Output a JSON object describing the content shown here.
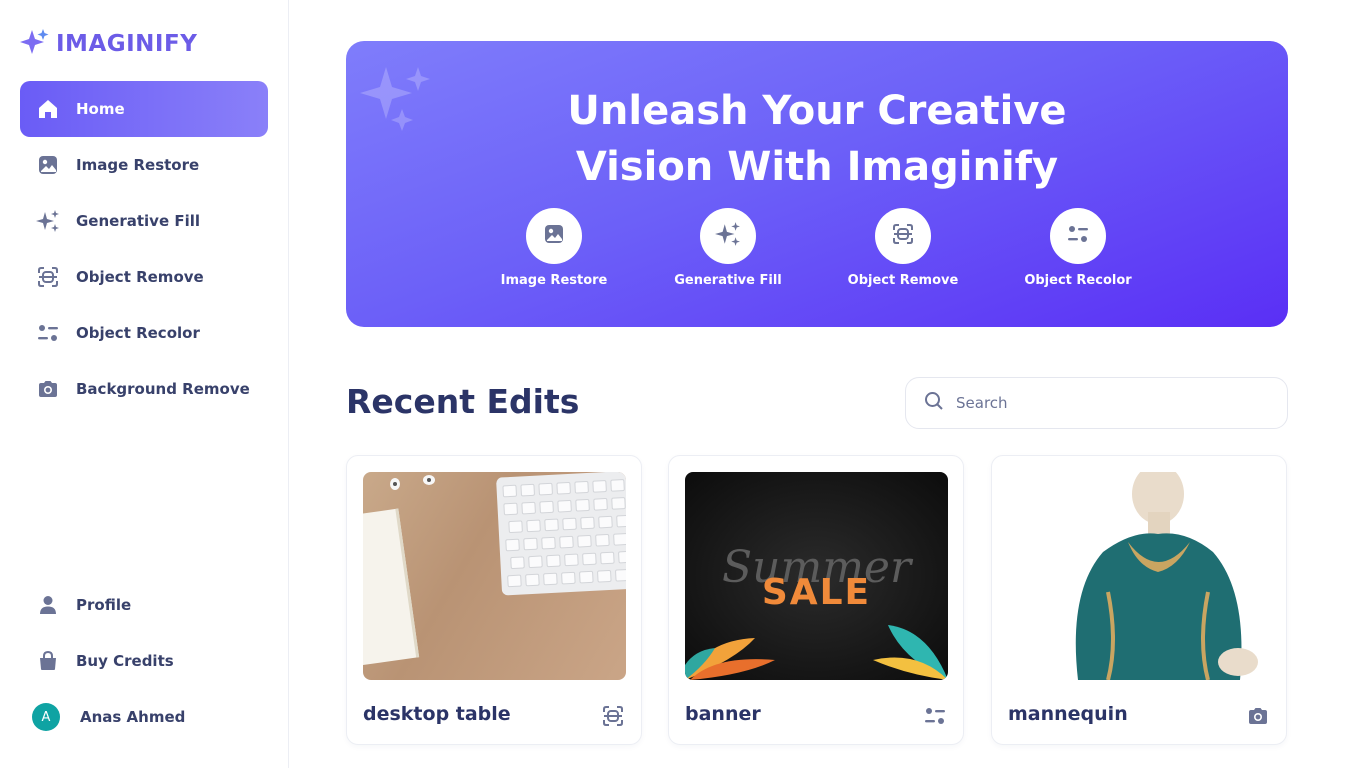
{
  "app": {
    "logo_text": "IMAGINIFY"
  },
  "sidebar": {
    "items": [
      {
        "label": "Home",
        "icon": "home-icon",
        "active": true
      },
      {
        "label": "Image Restore",
        "icon": "image-icon"
      },
      {
        "label": "Generative Fill",
        "icon": "sparkles-icon"
      },
      {
        "label": "Object Remove",
        "icon": "scan-icon"
      },
      {
        "label": "Object Recolor",
        "icon": "filter-icon"
      },
      {
        "label": "Background Remove",
        "icon": "camera-icon"
      }
    ],
    "bottom_items": [
      {
        "label": "Profile",
        "icon": "user-icon"
      },
      {
        "label": "Buy Credits",
        "icon": "bag-icon"
      }
    ],
    "user": {
      "initial": "A",
      "name": "Anas Ahmed"
    }
  },
  "hero": {
    "title_line1": "Unleash Your Creative",
    "title_line2": "Vision With Imaginify",
    "actions": [
      {
        "label": "Image Restore",
        "icon": "image-icon"
      },
      {
        "label": "Generative Fill",
        "icon": "sparkles-icon"
      },
      {
        "label": "Object Remove",
        "icon": "scan-icon"
      },
      {
        "label": "Object Recolor",
        "icon": "filter-icon"
      }
    ]
  },
  "recent": {
    "title": "Recent Edits",
    "search_placeholder": "Search",
    "cards": [
      {
        "title": "desktop table",
        "icon": "scan-icon"
      },
      {
        "title": "banner",
        "icon": "filter-icon"
      },
      {
        "title": "mannequin",
        "icon": "camera-icon"
      }
    ],
    "banner_text": {
      "summer": "Summer",
      "sale": "SALE"
    }
  },
  "colors": {
    "accent": "#6c5ce7",
    "text_dark": "#2b3467",
    "icon_gray": "#6b7395"
  }
}
